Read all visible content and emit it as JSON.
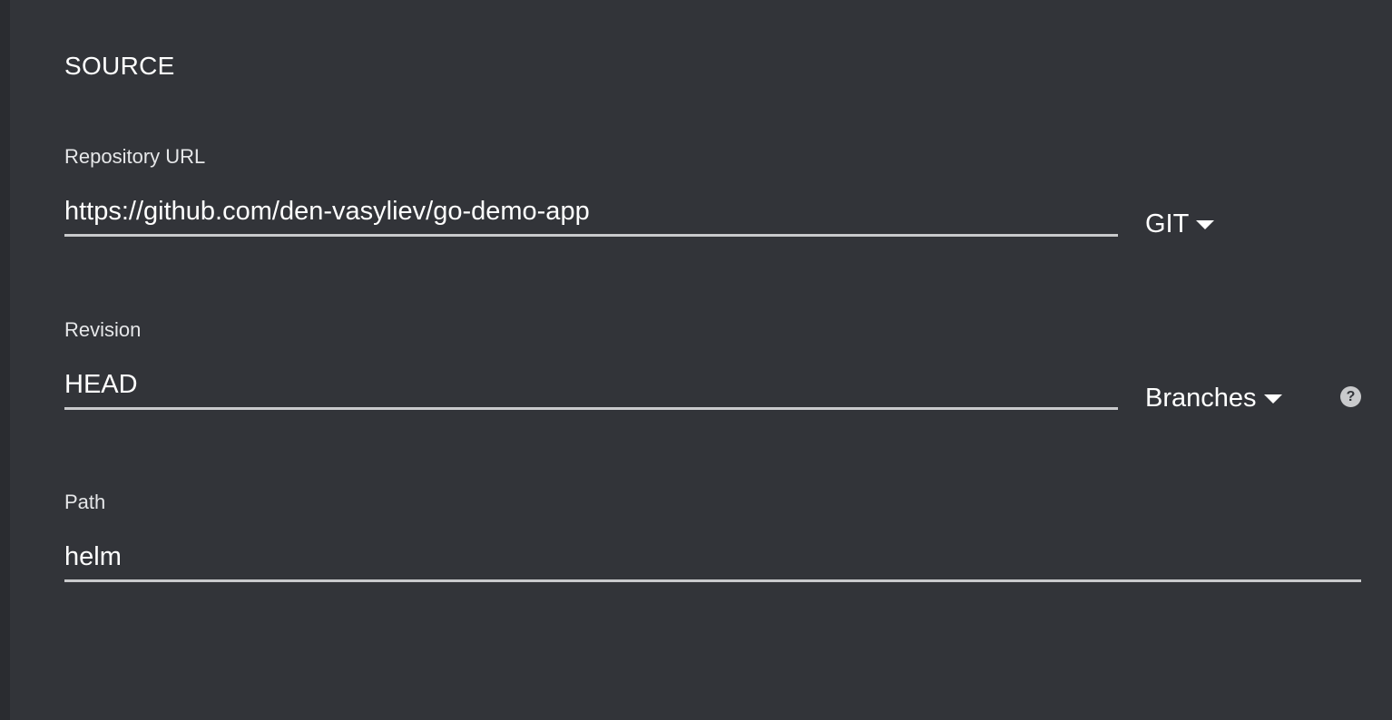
{
  "source": {
    "title": "SOURCE",
    "repository": {
      "label": "Repository URL",
      "value": "https://github.com/den-vasyliev/go-demo-app",
      "type_dropdown": "GIT",
      "type_dropdown_icon": "caret-down-icon"
    },
    "revision": {
      "label": "Revision",
      "value": "HEAD",
      "ref_dropdown": "Branches",
      "ref_dropdown_icon": "caret-down-icon",
      "help_icon": "help-icon",
      "help_glyph": "?"
    },
    "path": {
      "label": "Path",
      "value": "helm"
    }
  }
}
